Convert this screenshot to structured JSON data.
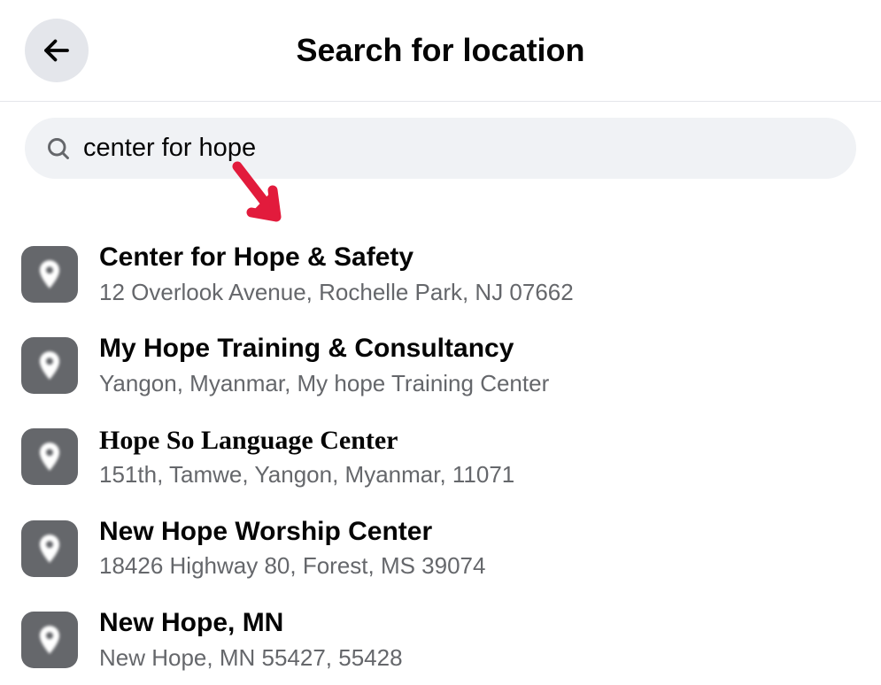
{
  "header": {
    "title": "Search for location"
  },
  "search": {
    "query": "center for hope"
  },
  "results": [
    {
      "name": "Center for Hope & Safety",
      "address": "12 Overlook Avenue, Rochelle Park, NJ 07662",
      "serif": false
    },
    {
      "name": "My Hope Training & Consultancy",
      "address": "Yangon, Myanmar, My hope Training Center",
      "serif": false
    },
    {
      "name": "Hope So Language Center",
      "address": "151th, Tamwe, Yangon, Myanmar, 11071",
      "serif": true
    },
    {
      "name": "New Hope Worship Center",
      "address": "18426 Highway 80, Forest, MS 39074",
      "serif": false
    },
    {
      "name": "New Hope, MN",
      "address": "New Hope, MN 55427, 55428",
      "serif": false
    }
  ]
}
